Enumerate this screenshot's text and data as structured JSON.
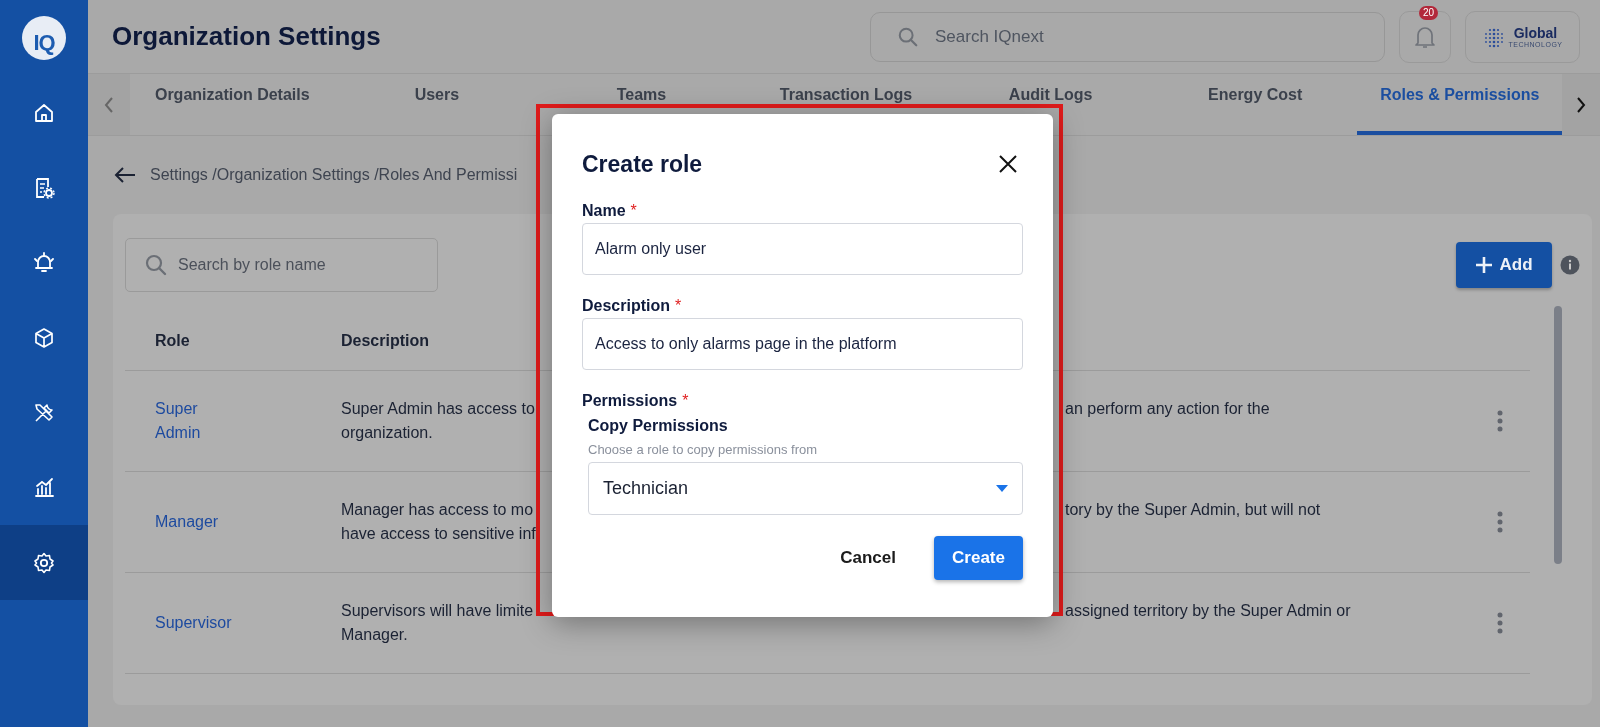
{
  "sidebar": {
    "logo_text": "IQ",
    "items": [
      {
        "selected": false
      },
      {
        "selected": false
      },
      {
        "selected": false
      },
      {
        "selected": false
      },
      {
        "selected": false
      },
      {
        "selected": false
      },
      {
        "selected": true
      }
    ]
  },
  "header": {
    "title": "Organization Settings",
    "search": {
      "placeholder": "Search IQnext"
    },
    "notifications": {
      "badge": "20"
    },
    "brand": {
      "name": "Global",
      "tagline": "TECHNOLOGY"
    }
  },
  "tabs": [
    {
      "label": "Organization Details",
      "selected": false
    },
    {
      "label": "Users",
      "selected": false
    },
    {
      "label": "Teams",
      "selected": false
    },
    {
      "label": "Transaction Logs",
      "selected": false
    },
    {
      "label": "Audit Logs",
      "selected": false
    },
    {
      "label": "Energy Cost",
      "selected": false
    },
    {
      "label": "Roles & Permissions",
      "selected": true
    }
  ],
  "breadcrumb": "Settings /Organization Settings /Roles And Permissi",
  "roles": {
    "search": {
      "placeholder": "Search by role name"
    },
    "add_button": {
      "label": "Add"
    },
    "table": {
      "columns": [
        "Role",
        "Description"
      ],
      "rows": [
        {
          "role": "Super Admin",
          "description_start": [
            "Super Admin has access to",
            "organization."
          ],
          "description_end": [
            "an perform any action for the"
          ]
        },
        {
          "role": "Manager",
          "description_start": [
            "Manager has access to mo",
            "have access to sensitive inf"
          ],
          "description_end": [
            "tory by the Super Admin, but will not"
          ]
        },
        {
          "role": "Supervisor",
          "description_start": [
            "Supervisors will have limite",
            "Manager."
          ],
          "description_end": [
            "assigned territory by the Super Admin or"
          ]
        }
      ]
    }
  },
  "dialog": {
    "title": "Create role",
    "fields": [
      {
        "kind": "text",
        "label": "Name",
        "required_mark": "*",
        "value": "Alarm only user"
      },
      {
        "kind": "text",
        "label": "Description",
        "required_mark": "*",
        "value": "Access to only alarms page in the platform"
      },
      {
        "kind": "group",
        "label": "Permissions",
        "required_mark": "*"
      },
      {
        "kind": "select",
        "label": "Copy Permissions",
        "hint": "Choose a role to copy permissions from",
        "value": "Technician"
      }
    ],
    "buttons": [
      {
        "kind": "text",
        "label": "Cancel"
      },
      {
        "kind": "primary",
        "label": "Create"
      }
    ]
  }
}
